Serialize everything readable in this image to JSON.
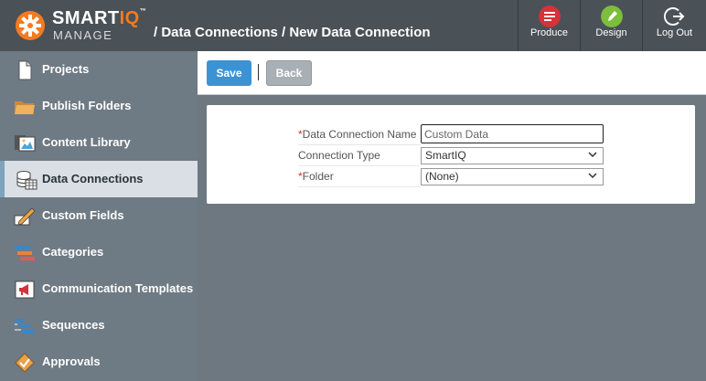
{
  "header": {
    "logo_smart": "SMART",
    "logo_iq": "IQ",
    "logo_tm": "™",
    "logo_sub": "MANAGE",
    "breadcrumb": "/ Data Connections / New Data Connection",
    "nav": [
      {
        "label": "Produce",
        "icon": "produce-icon",
        "color": "#d6323a"
      },
      {
        "label": "Design",
        "icon": "design-icon",
        "color": "#7dbe3c"
      },
      {
        "label": "Log Out",
        "icon": "logout-icon",
        "color": "#ffffff"
      }
    ]
  },
  "sidebar": {
    "items": [
      {
        "label": "Projects",
        "icon": "document-icon"
      },
      {
        "label": "Publish Folders",
        "icon": "folder-icon"
      },
      {
        "label": "Content Library",
        "icon": "image-library-icon"
      },
      {
        "label": "Data Connections",
        "icon": "database-icon",
        "active": true
      },
      {
        "label": "Custom Fields",
        "icon": "pencil-icon"
      },
      {
        "label": "Categories",
        "icon": "categories-icon"
      },
      {
        "label": "Communication Templates",
        "icon": "megaphone-icon"
      },
      {
        "label": "Sequences",
        "icon": "sequences-icon"
      },
      {
        "label": "Approvals",
        "icon": "approvals-icon"
      }
    ]
  },
  "toolbar": {
    "save_label": "Save",
    "back_label": "Back"
  },
  "form": {
    "name": {
      "required_mark": "*",
      "label": "Data Connection Name",
      "value": "Custom Data"
    },
    "type": {
      "label": "Connection Type",
      "value": "SmartIQ"
    },
    "folder": {
      "required_mark": "*",
      "label": "Folder",
      "value": "(None)"
    }
  },
  "colors": {
    "accent": "#3b93d4",
    "brand_orange": "#f47b20",
    "required": "#d0302f"
  }
}
